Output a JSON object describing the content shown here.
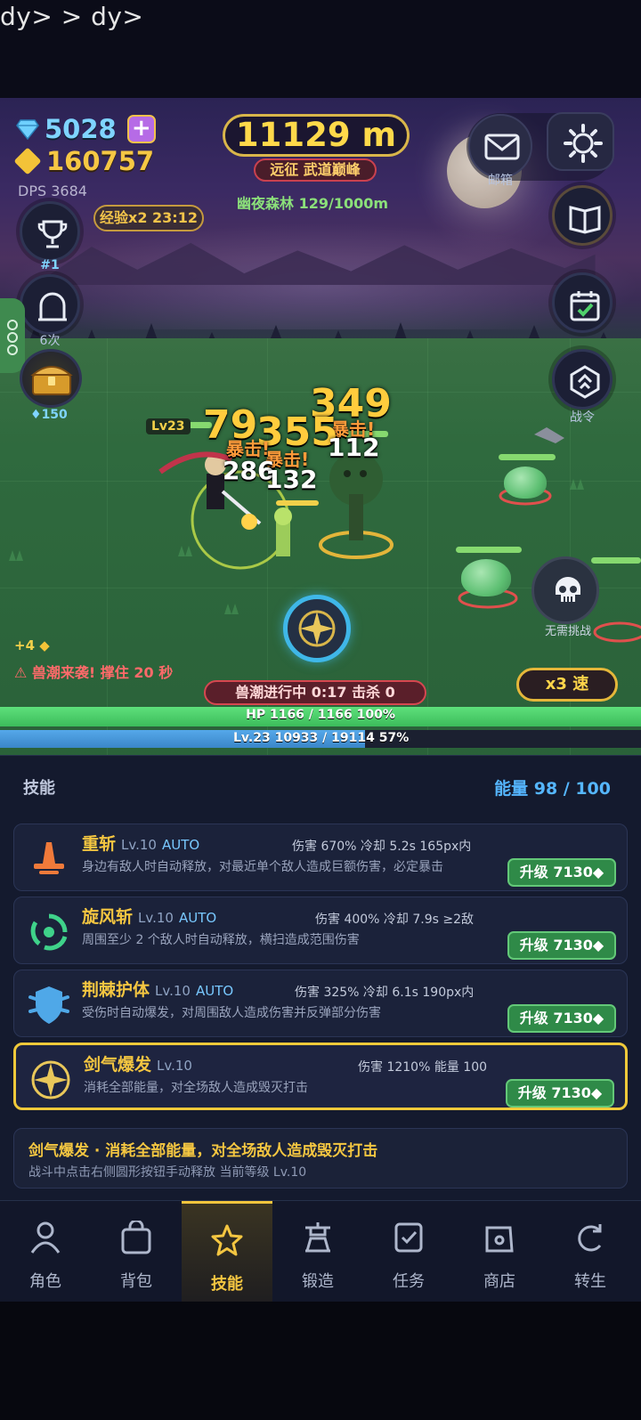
{
  "leak_text": "dy> > dy>",
  "resources": {
    "diamonds": "5028",
    "gold": "160757",
    "dps": "DPS 3684"
  },
  "distance": {
    "value": "11129 m",
    "route": "远征 武道巅峰",
    "area": "幽夜森林  129/1000m"
  },
  "exp_boost": "经验x2 23:12",
  "left_buttons": {
    "rank_label": "#1",
    "gate_label": "6次",
    "chest_price": "150"
  },
  "right_buttons": {
    "mail_label": "邮箱",
    "pass_label": "战令"
  },
  "combat": {
    "damage_numbers": [
      {
        "text": "349",
        "kind": "crit"
      },
      {
        "text": "暴击!",
        "kind": "critlbl"
      },
      {
        "text": "79",
        "kind": "crit"
      },
      {
        "text": "355",
        "kind": "crit"
      },
      {
        "text": "暴击!",
        "kind": "critlbl"
      },
      {
        "text": "暴击!",
        "kind": "critlbl"
      },
      {
        "text": "112",
        "kind": "norm"
      },
      {
        "text": "286",
        "kind": "norm"
      },
      {
        "text": "132",
        "kind": "norm"
      }
    ],
    "player_level": "Lv23",
    "skull_label": "无需挑战",
    "gold_gain": "+4",
    "warning": "⚠ 兽潮来袭! 撑住 20 秒",
    "wave_status": "兽潮进行中 0:17   击杀 0",
    "speed": "x3 速"
  },
  "bars": {
    "hp_text": "HP  1166 / 1166  100%",
    "hp_fraction": 1.0,
    "xp_text": "Lv.23   10933 / 19114   57%",
    "xp_fraction": 0.57
  },
  "skills_panel": {
    "title": "技能",
    "energy": "能量 98 / 100",
    "skills": [
      {
        "name": "重斩",
        "level": "Lv.10",
        "auto": "AUTO",
        "stats": "伤害 670%   冷却 5.2s   165px内",
        "desc": "身边有敌人时自动释放，对最近单个敌人造成巨额伤害，必定暴击",
        "upgrade": "升级 7130◆",
        "icon": "heavy-slash-icon"
      },
      {
        "name": "旋风斩",
        "level": "Lv.10",
        "auto": "AUTO",
        "stats": "伤害 400%   冷却 7.9s   ≥2敌",
        "desc": "周围至少 2 个敌人时自动释放，横扫造成范围伤害",
        "upgrade": "升级 7130◆",
        "icon": "whirlwind-icon"
      },
      {
        "name": "荆棘护体",
        "level": "Lv.10",
        "auto": "AUTO",
        "stats": "伤害 325%   冷却 6.1s   190px内",
        "desc": "受伤时自动爆发，对周围敌人造成伤害并反弹部分伤害",
        "upgrade": "升级 7130◆",
        "icon": "thorn-shield-icon"
      },
      {
        "name": "剑气爆发",
        "level": "Lv.10",
        "auto": "",
        "stats": "伤害 1210%   能量 100",
        "desc": "消耗全部能量，对全场敌人造成毁灭打击",
        "upgrade": "升级 7130◆",
        "icon": "sword-burst-icon"
      }
    ],
    "info_title": "剑气爆发 · 消耗全部能量，对全场敌人造成毁灭打击",
    "info_sub": "战斗中点击右侧圆形按钮手动释放    当前等级 Lv.10"
  },
  "nav": {
    "tabs": [
      {
        "label": "角色",
        "icon": "person-icon"
      },
      {
        "label": "背包",
        "icon": "bag-icon"
      },
      {
        "label": "技能",
        "icon": "star-icon"
      },
      {
        "label": "锻造",
        "icon": "anvil-icon"
      },
      {
        "label": "任务",
        "icon": "task-check-icon"
      },
      {
        "label": "商店",
        "icon": "shop-icon"
      },
      {
        "label": "转生",
        "icon": "rebirth-icon"
      }
    ],
    "active": "技能"
  },
  "colors": {
    "accent_gold": "#f4c641",
    "energy_blue": "#55b6ff",
    "hp_green": "#3cbc5b",
    "xp_blue": "#3a86c8"
  }
}
